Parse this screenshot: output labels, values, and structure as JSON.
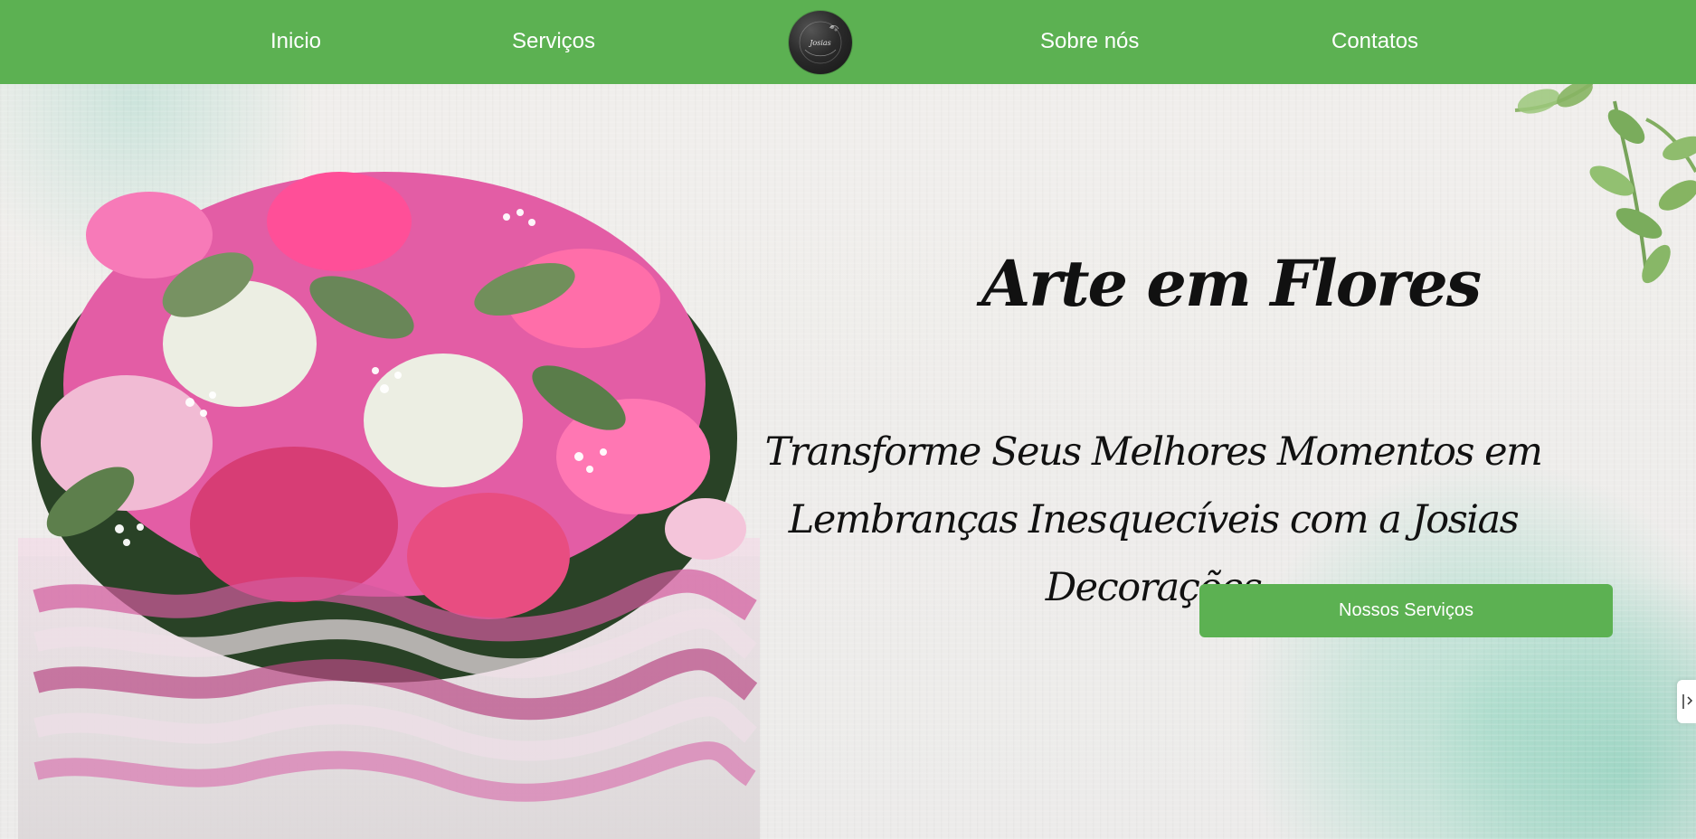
{
  "nav": {
    "items": [
      {
        "label": "Inicio"
      },
      {
        "label": "Serviços"
      },
      {
        "label": "Sobre nós"
      },
      {
        "label": "Contatos"
      }
    ],
    "logo_text": "Josias"
  },
  "hero": {
    "title": "Arte em Flores",
    "subtitle": "Transforme Seus Melhores Momentos em Lembranças Inesquecíveis com a Josias Decorações",
    "button_label": "Nossos Serviços"
  },
  "colors": {
    "brand_green": "#5cb152",
    "text_dark": "#111111",
    "background": "#efedeb"
  },
  "icons": {
    "logo": "circular-logo",
    "side_tab": "scroll-tab-icon"
  }
}
